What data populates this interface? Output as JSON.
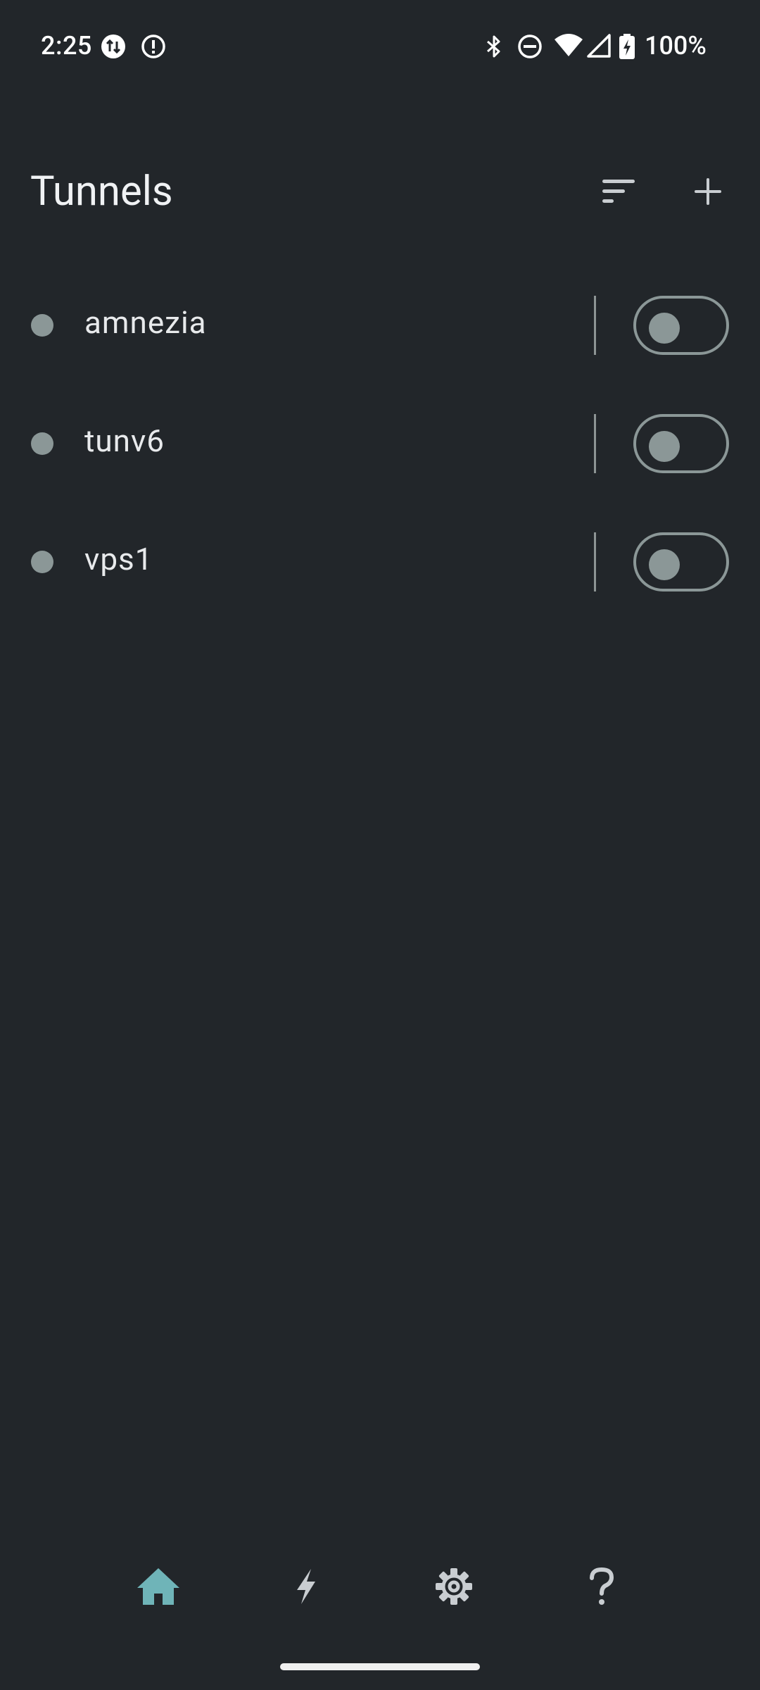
{
  "status_bar": {
    "time": "2:25",
    "battery": "100%",
    "icons": [
      "data-transfer-icon",
      "alert-icon",
      "bluetooth-icon",
      "do-not-disturb-icon",
      "wifi-icon",
      "cell-signal-icon",
      "battery-charging-icon"
    ]
  },
  "header": {
    "title": "Tunnels",
    "actions": [
      "sort-icon",
      "add-icon"
    ]
  },
  "tunnels": [
    {
      "name": "amnezia",
      "enabled": false
    },
    {
      "name": "tunv6",
      "enabled": false
    },
    {
      "name": "vps1",
      "enabled": false
    }
  ],
  "bottom_nav": {
    "items": [
      "home-icon",
      "bolt-icon",
      "settings-icon",
      "help-icon"
    ],
    "selected": "home-icon"
  },
  "colors": {
    "background": "#22262a",
    "accent": "#6fb4b8",
    "inactive": "#8b9797",
    "icon": "#c9cdd1"
  }
}
